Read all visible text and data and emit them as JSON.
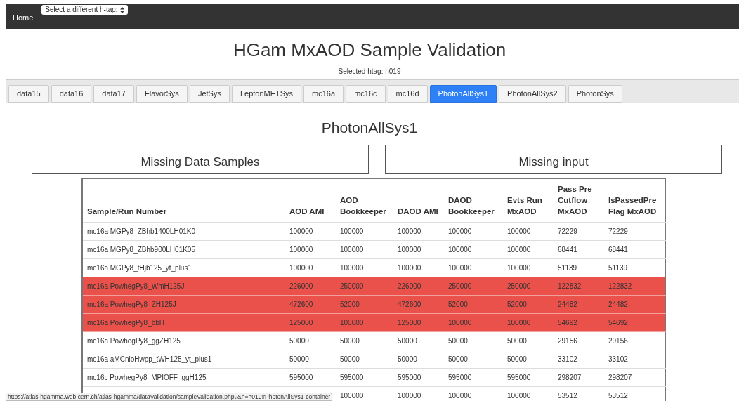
{
  "navbar": {
    "home": "Home",
    "htag_select": "Select a different h-tag:"
  },
  "title": "HGam MxAOD Sample Validation",
  "subtitle": "Selected htag: h019",
  "tabs": [
    {
      "label": "data15",
      "selected": false
    },
    {
      "label": "data16",
      "selected": false
    },
    {
      "label": "data17",
      "selected": false
    },
    {
      "label": "FlavorSys",
      "selected": false
    },
    {
      "label": "JetSys",
      "selected": false
    },
    {
      "label": "LeptonMETSys",
      "selected": false
    },
    {
      "label": "mc16a",
      "selected": false
    },
    {
      "label": "mc16c",
      "selected": false
    },
    {
      "label": "mc16d",
      "selected": false
    },
    {
      "label": "PhotonAllSys1",
      "selected": true
    },
    {
      "label": "PhotonAllSys2",
      "selected": false
    },
    {
      "label": "PhotonSys",
      "selected": false
    }
  ],
  "section_title": "PhotonAllSys1",
  "panels": [
    "Missing Data Samples",
    "Missing input"
  ],
  "table": {
    "columns": [
      "Sample/Run Number",
      "AOD AMI",
      "AOD Bookkeeper",
      "DAOD AMI",
      "DAOD Bookkeeper",
      "Evts Run MxAOD",
      "Pass Pre Cutflow MxAOD",
      "IsPassedPre Flag MxAOD"
    ],
    "rows": [
      {
        "highlighted": false,
        "cells": [
          "mc16a MGPy8_ZBhb1400LH01K0",
          "100000",
          "100000",
          "100000",
          "100000",
          "100000",
          "72229",
          "72229"
        ]
      },
      {
        "highlighted": false,
        "cells": [
          "mc16a MGPy8_ZBhb900LH01K05",
          "100000",
          "100000",
          "100000",
          "100000",
          "100000",
          "68441",
          "68441"
        ]
      },
      {
        "highlighted": false,
        "cells": [
          "mc16a MGPy8_tHjb125_yt_plus1",
          "100000",
          "100000",
          "100000",
          "100000",
          "100000",
          "51139",
          "51139"
        ]
      },
      {
        "highlighted": true,
        "cells": [
          "mc16a PowhegPy8_WmH125J",
          "226000",
          "250000",
          "226000",
          "250000",
          "250000",
          "122832",
          "122832"
        ]
      },
      {
        "highlighted": true,
        "cells": [
          "mc16a PowhegPy8_ZH125J",
          "472600",
          "52000",
          "472600",
          "52000",
          "52000",
          "24482",
          "24482"
        ]
      },
      {
        "highlighted": true,
        "cells": [
          "mc16a PowhegPy8_bbH",
          "125000",
          "100000",
          "125000",
          "100000",
          "100000",
          "54692",
          "54692"
        ]
      },
      {
        "highlighted": false,
        "cells": [
          "mc16a PowhegPy8_ggZH125",
          "50000",
          "50000",
          "50000",
          "50000",
          "50000",
          "29156",
          "29156"
        ]
      },
      {
        "highlighted": false,
        "cells": [
          "mc16a aMCnloHwpp_tWH125_yt_plus1",
          "50000",
          "50000",
          "50000",
          "50000",
          "50000",
          "33102",
          "33102"
        ]
      },
      {
        "highlighted": false,
        "cells": [
          "mc16c PowhegPy8_MPIOFF_ggH125",
          "595000",
          "595000",
          "595000",
          "595000",
          "595000",
          "298207",
          "298207"
        ]
      },
      {
        "highlighted": false,
        "cells": [
          "",
          "",
          "100000",
          "100000",
          "100000",
          "100000",
          "53512",
          "53512"
        ]
      }
    ]
  },
  "status_url": "https://atlas-hgamma.web.cern.ch/atlas-hgamma/dataValidation/sampleValidation.php?&h=h019#PhotonAllSys1-container"
}
